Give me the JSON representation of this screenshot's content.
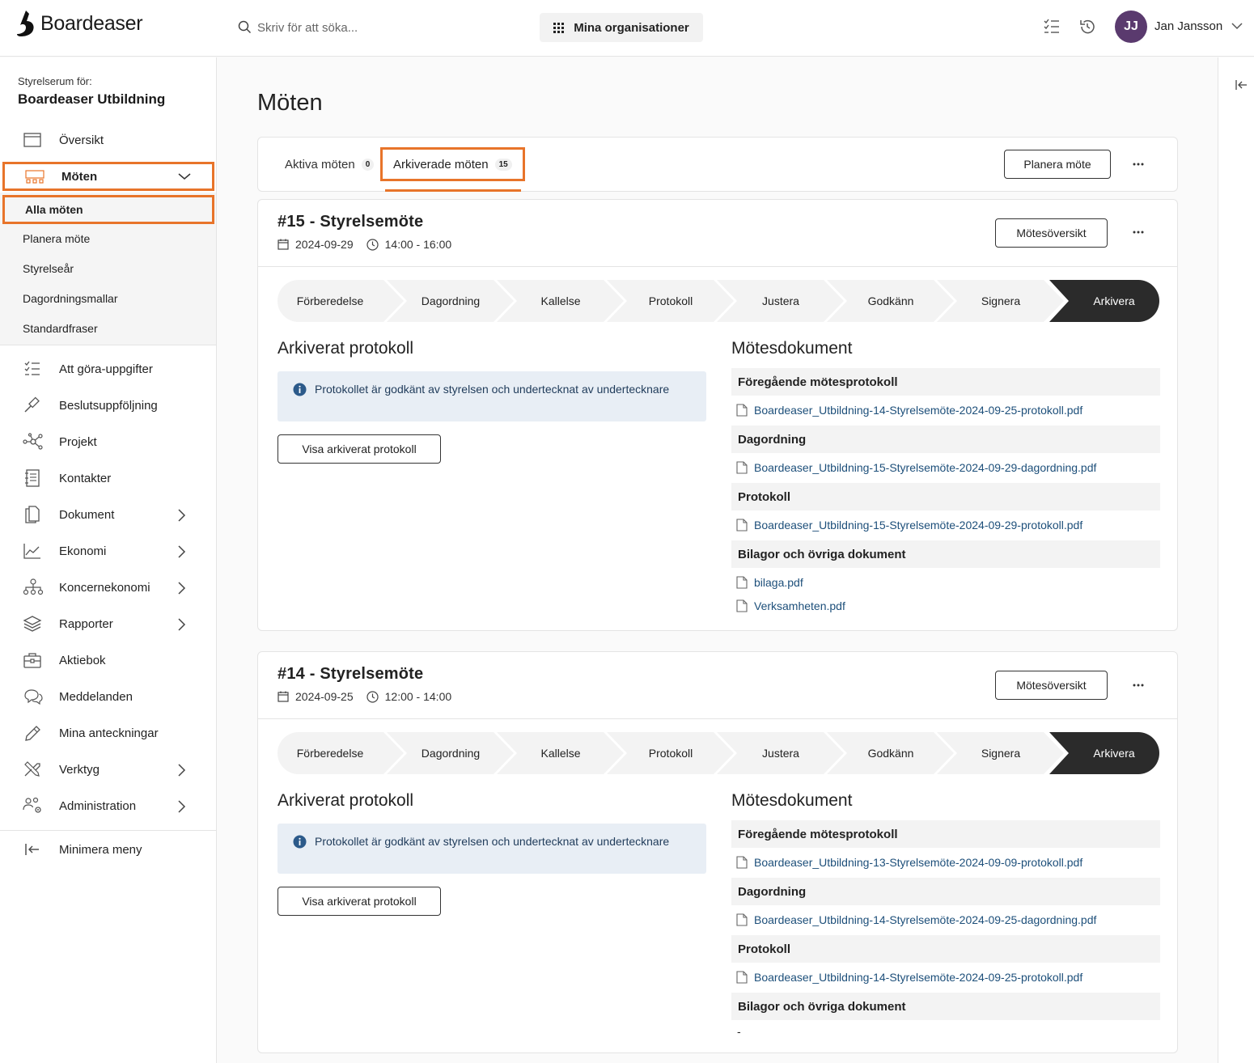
{
  "app": {
    "name": "Boardeaser"
  },
  "search": {
    "placeholder": "Skriv för att söka..."
  },
  "header": {
    "org_button": "Mina organisationer",
    "user_initials": "JJ",
    "user_name": "Jan Jansson"
  },
  "sidebar": {
    "room_label": "Styrelserum för:",
    "room_name": "Boardeaser Utbildning",
    "overview": "Översikt",
    "meetings": "Möten",
    "sub_items": [
      "Alla möten",
      "Planera möte",
      "Styrelseår",
      "Dagordningsmallar",
      "Standardfraser"
    ],
    "items": [
      {
        "label": "Att göra-uppgifter",
        "icon": "checklist-icon",
        "chevron": false
      },
      {
        "label": "Beslutsuppföljning",
        "icon": "gavel-icon",
        "chevron": false
      },
      {
        "label": "Projekt",
        "icon": "network-icon",
        "chevron": false
      },
      {
        "label": "Kontakter",
        "icon": "contacts-book-icon",
        "chevron": false
      },
      {
        "label": "Dokument",
        "icon": "documents-icon",
        "chevron": true
      },
      {
        "label": "Ekonomi",
        "icon": "line-chart-icon",
        "chevron": true
      },
      {
        "label": "Koncernekonomi",
        "icon": "org-chart-icon",
        "chevron": true
      },
      {
        "label": "Rapporter",
        "icon": "layers-icon",
        "chevron": true
      },
      {
        "label": "Aktiebok",
        "icon": "briefcase-icon",
        "chevron": false
      },
      {
        "label": "Meddelanden",
        "icon": "chat-bubbles-icon",
        "chevron": false
      },
      {
        "label": "Mina anteckningar",
        "icon": "pencil-icon",
        "chevron": false
      },
      {
        "label": "Verktyg",
        "icon": "tools-icon",
        "chevron": true
      },
      {
        "label": "Administration",
        "icon": "users-gear-icon",
        "chevron": true
      }
    ],
    "minimize": "Minimera meny"
  },
  "page": {
    "title": "Möten",
    "tabs": [
      {
        "label": "Aktiva möten",
        "count": "0"
      },
      {
        "label": "Arkiverade möten",
        "count": "15"
      }
    ],
    "plan_button": "Planera möte"
  },
  "steps": [
    "Förberedelse",
    "Dagordning",
    "Kallelse",
    "Protokoll",
    "Justera",
    "Godkänn",
    "Signera",
    "Arkivera"
  ],
  "meetings": [
    {
      "title": "#15 - Styrelsemöte",
      "date": "2024-09-29",
      "time": "14:00 - 16:00",
      "overview_button": "Mötesöversikt",
      "archived_title": "Arkiverat protokoll",
      "info": "Protokollet är godkänt av styrelsen och undertecknat av undertecknare",
      "view_button": "Visa arkiverat protokoll",
      "docs_title": "Mötesdokument",
      "sections": [
        {
          "heading": "Föregående mötesprotokoll",
          "files": [
            "Boardeaser_Utbildning-14-Styrelsemöte-2024-09-25-protokoll.pdf"
          ]
        },
        {
          "heading": "Dagordning",
          "files": [
            "Boardeaser_Utbildning-15-Styrelsemöte-2024-09-29-dagordning.pdf"
          ]
        },
        {
          "heading": "Protokoll",
          "files": [
            "Boardeaser_Utbildning-15-Styrelsemöte-2024-09-29-protokoll.pdf"
          ]
        },
        {
          "heading": "Bilagor och övriga dokument",
          "files": [
            "bilaga.pdf",
            "Verksamheten.pdf"
          ]
        }
      ]
    },
    {
      "title": "#14 - Styrelsemöte",
      "date": "2024-09-25",
      "time": "12:00 - 14:00",
      "overview_button": "Mötesöversikt",
      "archived_title": "Arkiverat protokoll",
      "info": "Protokollet är godkänt av styrelsen och undertecknat av undertecknare",
      "view_button": "Visa arkiverat protokoll",
      "docs_title": "Mötesdokument",
      "sections": [
        {
          "heading": "Föregående mötesprotokoll",
          "files": [
            "Boardeaser_Utbildning-13-Styrelsemöte-2024-09-09-protokoll.pdf"
          ]
        },
        {
          "heading": "Dagordning",
          "files": [
            "Boardeaser_Utbildning-14-Styrelsemöte-2024-09-25-dagordning.pdf"
          ]
        },
        {
          "heading": "Protokoll",
          "files": [
            "Boardeaser_Utbildning-14-Styrelsemöte-2024-09-25-protokoll.pdf"
          ]
        },
        {
          "heading": "Bilagor och övriga dokument",
          "files": [],
          "empty": "-"
        }
      ]
    }
  ],
  "colors": {
    "accent": "#e8742a",
    "active_step": "#2b2b2b",
    "link": "#1d4f7a",
    "avatar": "#5a3a6e"
  }
}
